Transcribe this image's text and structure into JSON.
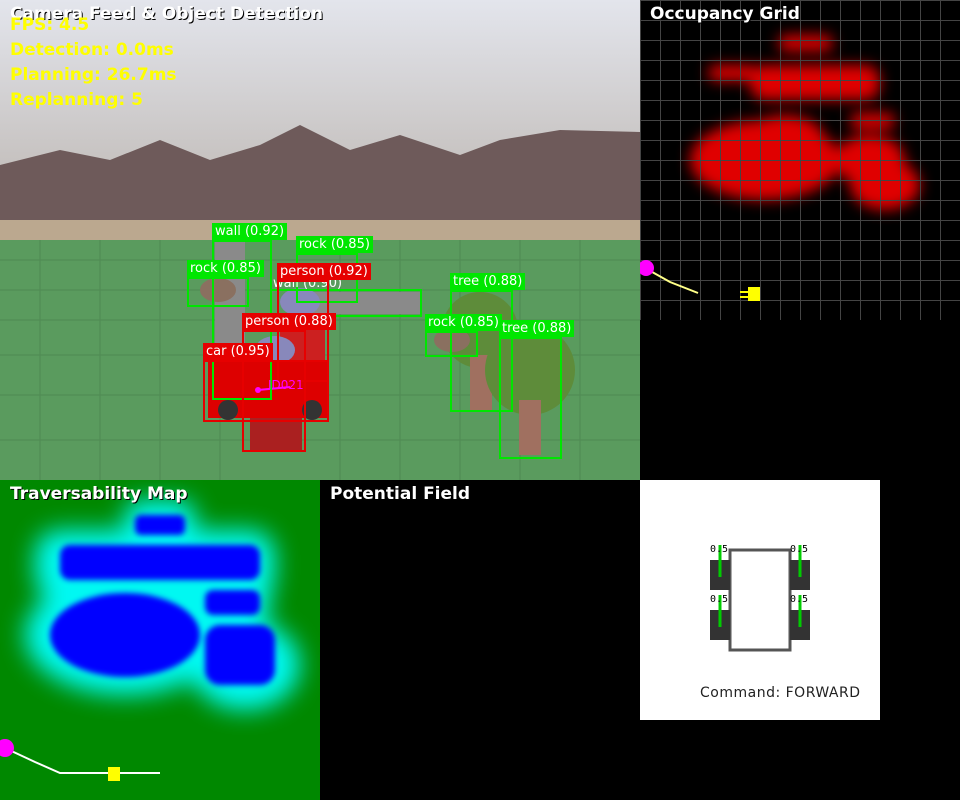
{
  "panels": {
    "camera": {
      "title": "Camera Feed & Object Detection"
    },
    "occupancy": {
      "title": "Occupancy Grid"
    },
    "traversability": {
      "title": "Traversability Map"
    },
    "potential": {
      "title": "Potential Field"
    }
  },
  "stats": {
    "fps": "FPS: 4.5",
    "detection": "Detection: 0.0ms",
    "planning": "Planning: 26.7ms",
    "replanning": "Replanning: 5"
  },
  "detections": [
    {
      "label": "wall (0.92)",
      "class": "wall",
      "color": "#00e600"
    },
    {
      "label": "rock (0.85)",
      "class": "rock",
      "color": "#00e600"
    },
    {
      "label": "rock (0.85)",
      "class": "rock",
      "color": "#00e600"
    },
    {
      "label": "person (0.92)",
      "class": "person",
      "color": "#e60000"
    },
    {
      "label": "wall (0.90)",
      "class": "wall",
      "color": "#00e600"
    },
    {
      "label": "person (0.88)",
      "class": "person",
      "color": "#e60000"
    },
    {
      "label": "car (0.95)",
      "class": "car",
      "color": "#e60000"
    },
    {
      "label": "tree (0.88)",
      "class": "tree",
      "color": "#00e600"
    },
    {
      "label": "rock (0.85)",
      "class": "rock",
      "color": "#00e600"
    },
    {
      "label": "tree (0.88)",
      "class": "tree",
      "color": "#00e600"
    }
  ],
  "track_id": "ID021",
  "robot": {
    "wheel_values": [
      "0.5",
      "0.5",
      "0.5",
      "0.5"
    ],
    "command": "Command: FORWARD"
  },
  "colors": {
    "sky_top": "#dde0e8",
    "sky_bottom": "#b8b4b2",
    "mountains": "#6e5a5a",
    "ground": "#5a9b5e",
    "trav_bg": "#008800",
    "obstacle": "#0000ff",
    "halo": "#00ffff",
    "stat_text": "#ffff00",
    "tracker": "#ff00ff"
  }
}
